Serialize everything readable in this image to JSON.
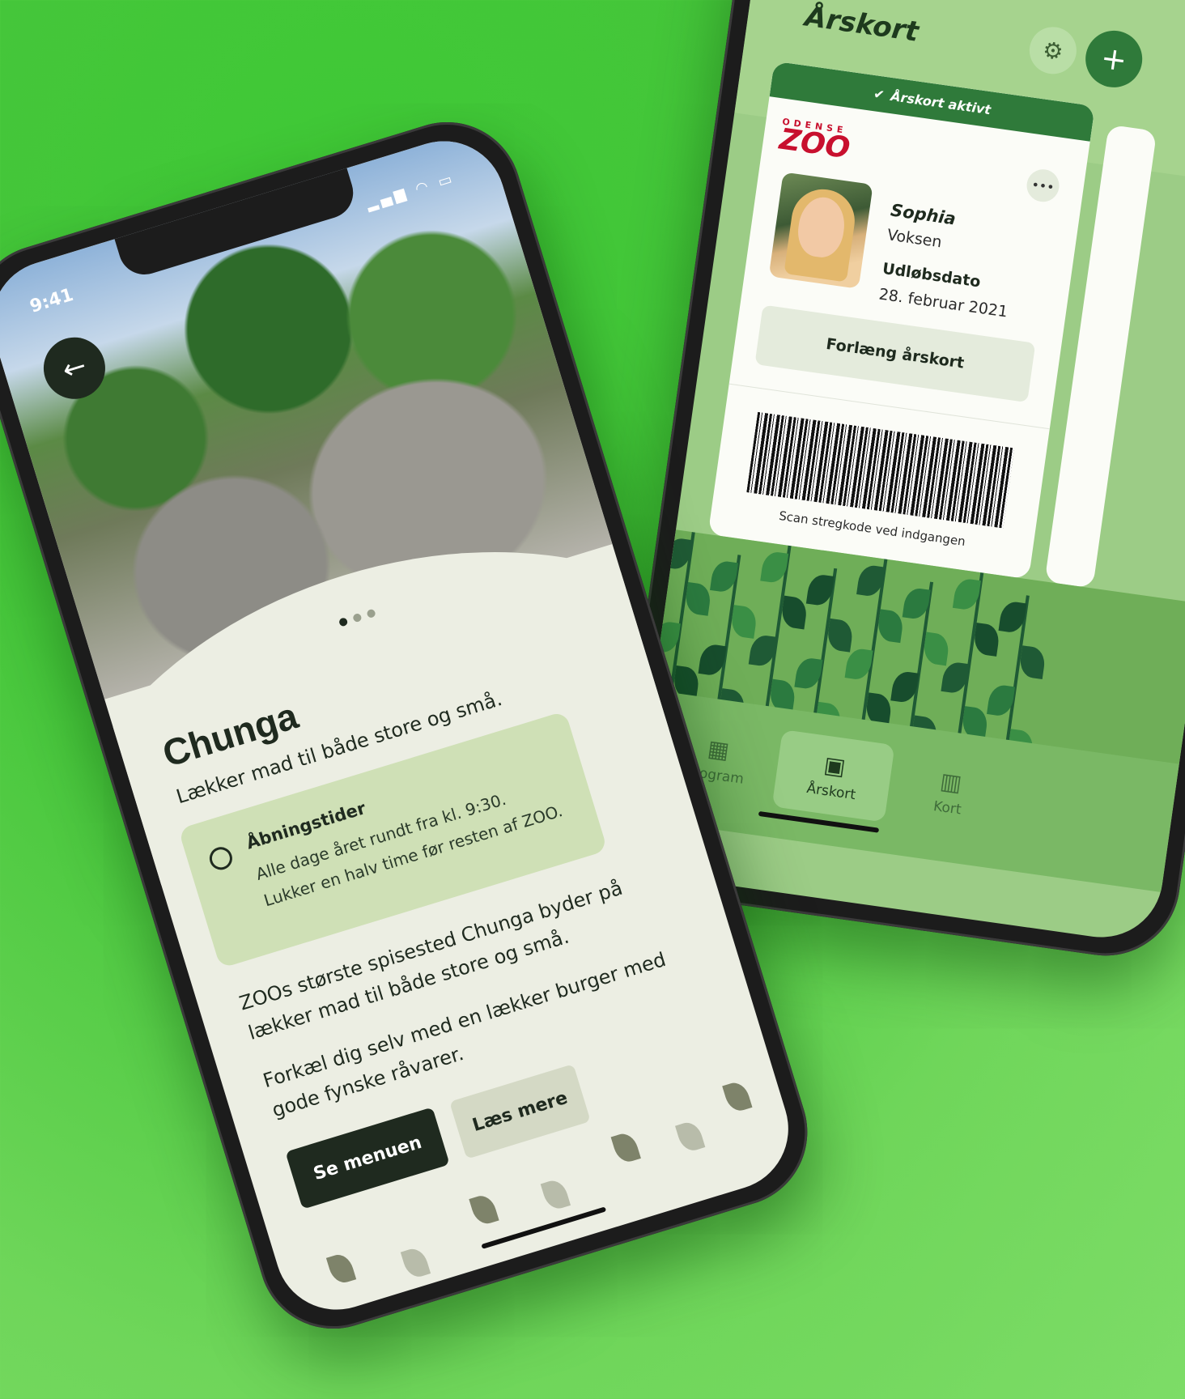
{
  "left_phone": {
    "status": {
      "time": "9:41"
    },
    "title": "Chunga",
    "subtitle": "Lækker mad til både store og små.",
    "hours": {
      "title": "Åbningstider",
      "line1": "Alle dage året rundt fra kl. 9:30.",
      "line2": "Lukker en halv time før resten af ZOO."
    },
    "description": [
      "ZOOs største spisested Chunga byder på lækker mad til både store og små.",
      "Forkæl dig selv med en lækker burger med gode fynske råvarer."
    ],
    "buttons": {
      "menu": "Se menuen",
      "more": "Læs mere"
    },
    "carousel": {
      "count": 3,
      "active": 0
    }
  },
  "right_phone": {
    "title": "Årskort",
    "card": {
      "status": "Årskort aktivt",
      "logo_top": "ODENSE",
      "logo_main": "ZOO",
      "name": "Sophia",
      "type": "Voksen",
      "expiry_label": "Udløbsdato",
      "expiry_date": "28. februar 2021",
      "renew_button": "Forlæng årskort",
      "scan_text": "Scan stregkode ved indgangen"
    },
    "tabs": [
      {
        "label": "Program",
        "icon": "calendar-icon"
      },
      {
        "label": "Årskort",
        "icon": "id-card-icon",
        "active": true
      },
      {
        "label": "Kort",
        "icon": "map-icon"
      }
    ]
  },
  "colors": {
    "background": "#45c63a",
    "dark": "#1f2a1f",
    "accent_green": "#2f7a3a",
    "brand_red": "#c8102e"
  }
}
